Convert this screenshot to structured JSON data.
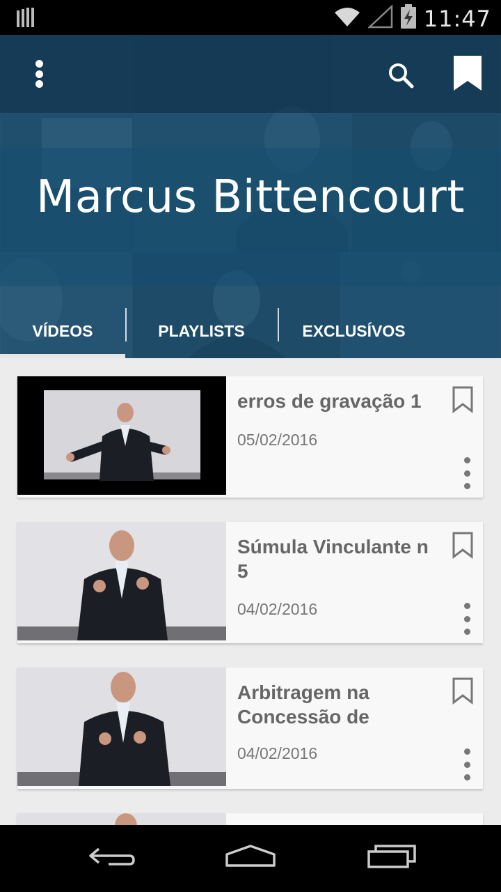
{
  "status_bar": {
    "time": "11:47",
    "icons": [
      "signal-bars-icon",
      "wifi-icon",
      "no-signal-icon",
      "battery-charging-icon"
    ]
  },
  "toolbar": {
    "menu_icon": "overflow-menu-icon",
    "search_icon": "search-icon",
    "bookmark_icon": "bookmark-icon"
  },
  "channel": {
    "title": "Marcus Bittencourt"
  },
  "tabs": [
    {
      "label": "VÍDEOS",
      "selected": true
    },
    {
      "label": "PLAYLISTS",
      "selected": false
    },
    {
      "label": "EXCLUSÍVOS",
      "selected": false
    }
  ],
  "videos": [
    {
      "title": "erros de gravação 1",
      "date": "05/02/2016"
    },
    {
      "title": "Súmula Vinculante n 5",
      "date": "04/02/2016"
    },
    {
      "title": "Arbitragem na Concessão de",
      "date": "04/02/2016"
    }
  ],
  "nav_bar": {
    "icons": [
      "back-icon",
      "home-icon",
      "recents-icon"
    ]
  },
  "colors": {
    "header_tint": "#1d4a68",
    "tab_indicator": "#e6e6e6",
    "list_background": "#ececec",
    "card_background": "#f8f8f8",
    "card_text": "#666666"
  }
}
